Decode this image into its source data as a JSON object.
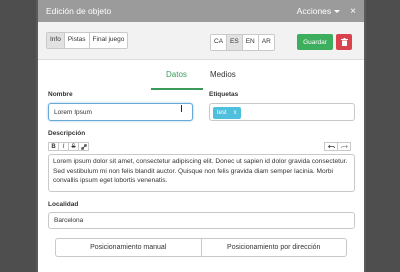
{
  "header": {
    "title": "Edición de objeto",
    "actions_label": "Acciones",
    "close_glyph": "×"
  },
  "toolbar": {
    "section_tabs": [
      "Info",
      "Pistas",
      "Final juego"
    ],
    "active_section": "Info",
    "languages": [
      "CA",
      "ES",
      "EN",
      "AR"
    ],
    "active_language": "ES",
    "save_label": "Guardar",
    "delete_icon": "trash-icon",
    "colors": {
      "save": "#3dae5d",
      "delete": "#d9434e"
    }
  },
  "tabs": {
    "datos": "Datos",
    "medios": "Medios",
    "active": "Datos",
    "accent": "#3a9a5a"
  },
  "form": {
    "nombre_label": "Nombre",
    "nombre_value": "Lorem Ipsum",
    "etiquetas_label": "Etiquetas",
    "tag_text": "test",
    "tag_remove": "x",
    "descripcion_label": "Descripción",
    "format_buttons": [
      "B",
      "I",
      "S",
      "link"
    ],
    "descripcion_text": "Lorem ipsum dolor sit amet, consectetur adipiscing elit. Donec ut sapien id dolor gravida consectetur. Sed vestibulum mi non felis blandit auctor. Quisque non felis gravida diam semper lacinia. Morbi convallis ipsum eget lobortis venenatis.",
    "localidad_label": "Localidad",
    "localidad_value": "Barcelona",
    "pos_manual": "Posicionamiento manual",
    "pos_direccion": "Posicionamiento por dirección"
  }
}
